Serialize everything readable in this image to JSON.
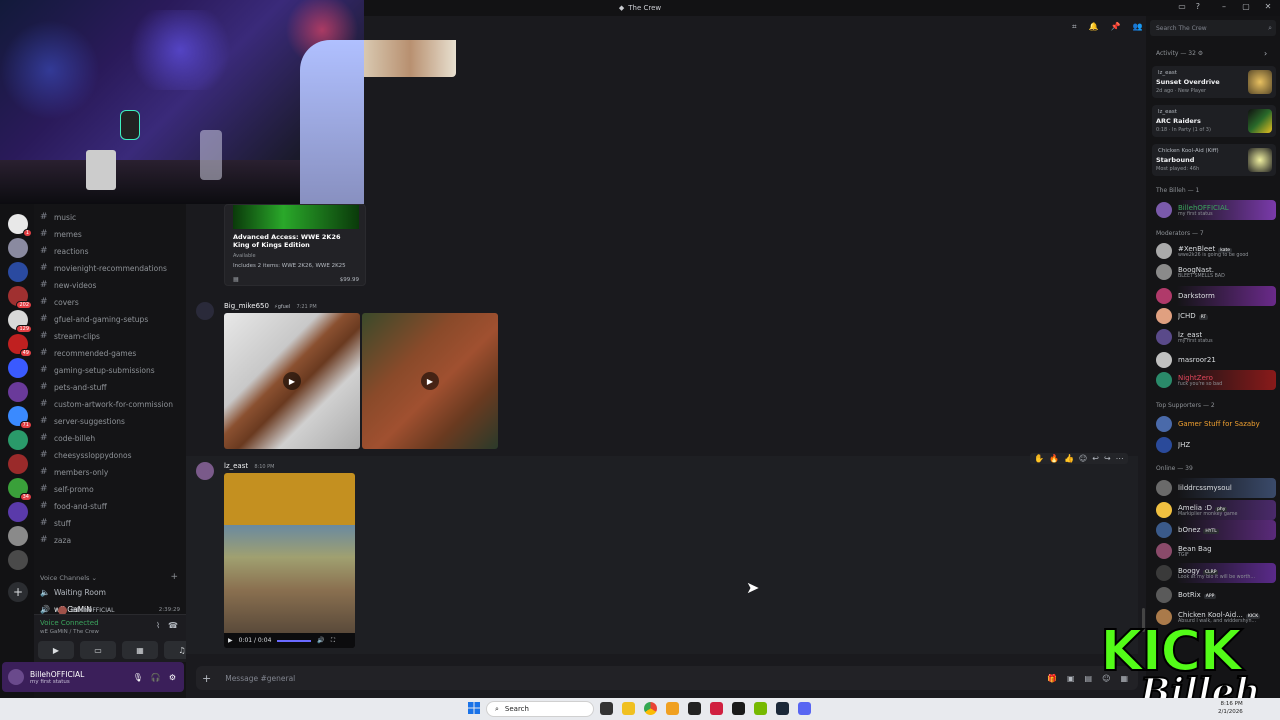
{
  "window": {
    "title": "The Crew"
  },
  "channels": [
    "music",
    "memes",
    "reactions",
    "movienight-recommendations",
    "new-videos",
    "covers",
    "gfuel-and-gaming-setups",
    "stream-clips",
    "recommended-games",
    "gaming-setup-submissions",
    "pets-and-stuff",
    "custom-artwork-for-commission",
    "server-suggestions",
    "code-billeh",
    "cheesyssloppydonos",
    "members-only",
    "self-promo",
    "food-and-stuff",
    "stuff",
    "zaza"
  ],
  "voice": {
    "header": "Voice Channels",
    "channels": [
      "Waiting Room",
      "wE GaMiN"
    ],
    "time": "2:39:29",
    "user_in_channel": "BillehOFFICIAL",
    "connected": "Voice Connected",
    "connected_sub": "wE GaMiN / The Crew"
  },
  "self_user": {
    "name": "BillehOFFICIAL",
    "status": "my first status"
  },
  "server_badges": [
    "1",
    "202",
    "129",
    "49",
    "71",
    "34"
  ],
  "embed": {
    "title": "Advanced Access: WWE 2K26 King of Kings Edition",
    "availability": "Available",
    "includes": "Includes 2 items: WWE 2K26, WWE 2K25",
    "price": "$99.99"
  },
  "messages": [
    {
      "author": "Big_mike650",
      "tag": "gfuel",
      "time": "7:21 PM"
    },
    {
      "author": "lz_east",
      "time": "8:10 PM"
    }
  ],
  "video_player": {
    "time": "0:01 / 0:04"
  },
  "composer": {
    "placeholder": "Message #general"
  },
  "search": {
    "placeholder": "Search The Crew"
  },
  "activity": {
    "header": "Activity — 32",
    "cards": [
      {
        "user": "lz_east",
        "game": "Sunset Overdrive",
        "sub": "2d ago · New Player"
      },
      {
        "user": "lz_east",
        "game": "ARC Raiders",
        "sub": "0:18 · In Party (1 of 3)"
      },
      {
        "user": "Chicken Kool-Aid (Kiff)",
        "game": "Starbound",
        "sub": "Most played: 46h"
      }
    ]
  },
  "groups": [
    {
      "header": "The Billeh — 1",
      "members": [
        {
          "name": "BillehOFFICIAL",
          "sub": "my first status",
          "color": "#3ba55d"
        }
      ]
    },
    {
      "header": "Moderators — 7",
      "members": [
        {
          "name": "#XenBleet",
          "tag": "kate",
          "sub": "wwe2k26 is going to be good",
          "color": "#dbdee1"
        },
        {
          "name": "BoogNast.",
          "sub": "BLEET SMELLS BAD",
          "color": "#dbdee1"
        },
        {
          "name": "Darkstorm",
          "sub": "",
          "color": "#dbdee1"
        },
        {
          "name": "JCHD",
          "tag": "RT",
          "sub": "",
          "color": "#dbdee1"
        },
        {
          "name": "lz_east",
          "sub": "my first status",
          "color": "#dbdee1"
        },
        {
          "name": "masroor21",
          "sub": "",
          "color": "#dbdee1"
        },
        {
          "name": "NightZero",
          "sub": "fuck you're so bad",
          "color": "#e0455a"
        }
      ]
    },
    {
      "header": "Top Supporters — 2",
      "members": [
        {
          "name": "Gamer Stuff for Sazaby",
          "sub": "",
          "color": "#f0a030"
        },
        {
          "name": "JHZ",
          "sub": "",
          "color": "#dbdee1"
        }
      ]
    },
    {
      "header": "Online — 39",
      "members": [
        {
          "name": "lilddrcssmysoul",
          "sub": "",
          "color": "#dbdee1"
        },
        {
          "name": "Amelia :D",
          "tag": "phy",
          "sub": "Markiplier monkey game",
          "color": "#dbdee1"
        },
        {
          "name": "bOnez",
          "tag": "HYTL",
          "sub": "",
          "color": "#dbdee1"
        },
        {
          "name": "Bean Bag",
          "sub": "TGIF",
          "color": "#dbdee1"
        },
        {
          "name": "Boogy",
          "tag": "CLRP",
          "sub": "Look at my bio it will be worth...",
          "color": "#dbdee1"
        },
        {
          "name": "BotRix",
          "tag": "APP",
          "sub": "",
          "color": "#dbdee1"
        },
        {
          "name": "Chicken Kool-Aid...",
          "tag": "KICK",
          "sub": "Absurd I walk, and widdershyn...",
          "color": "#dbdee1"
        }
      ]
    }
  ],
  "overlay": {
    "kick_top": "KICK",
    "kick_bottom": "Billeh"
  },
  "taskbar": {
    "search": "Search",
    "time": "8:16 PM",
    "date": "2/1/2026"
  },
  "colors": {
    "accent": "#5865f2",
    "online": "#3ba55d",
    "kick_green": "#53fc18",
    "userbar": "#3b1f5a"
  }
}
